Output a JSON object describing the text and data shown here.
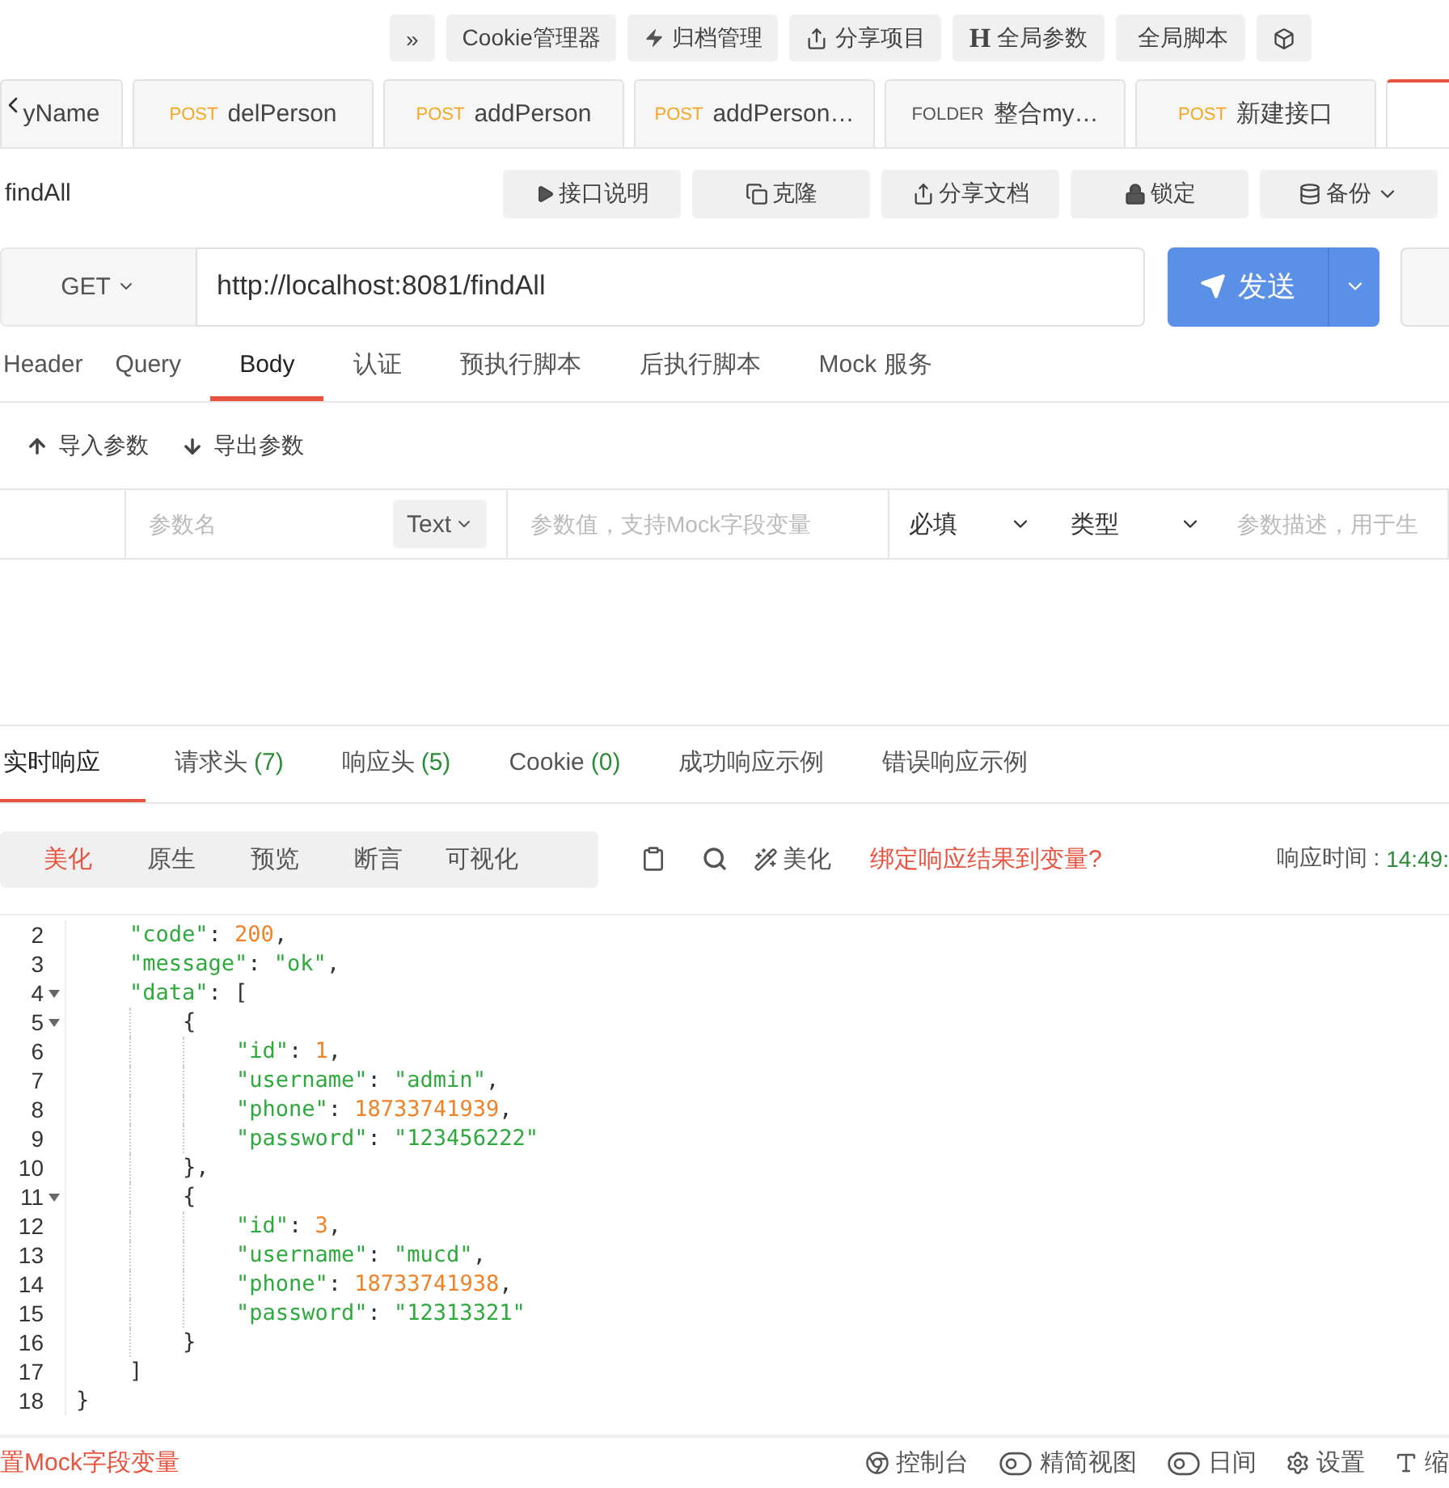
{
  "top_toolbar": [
    {
      "label": "»"
    },
    {
      "label": "Cookie管理器"
    },
    {
      "label": "归档管理"
    },
    {
      "label": "分享项目"
    },
    {
      "glyph": "H",
      "label": "全局参数"
    },
    {
      "label": "全局脚本"
    }
  ],
  "request_tabs": [
    {
      "label": "yName",
      "selected": false
    },
    {
      "method": "POST",
      "label": "delPerson",
      "selected": false
    },
    {
      "method": "POST",
      "label": "addPerson",
      "selected": false
    },
    {
      "method": "POST",
      "label": "addPerson…",
      "selected": false
    },
    {
      "method": "FOLDER",
      "label": "整合my…",
      "selected": false
    },
    {
      "method": "POST",
      "label": "新建接口",
      "selected": false
    },
    {
      "selected": true
    }
  ],
  "api_name": "findAll",
  "api_actions": [
    {
      "label": "接口说明"
    },
    {
      "label": "克隆"
    },
    {
      "label": "分享文档"
    },
    {
      "label": "锁定"
    },
    {
      "label": "备份"
    }
  ],
  "request": {
    "method": "GET",
    "url": "http://localhost:8081/findAll",
    "send": "发送"
  },
  "param_tabs": [
    {
      "label": "Header",
      "selected": false
    },
    {
      "label": "Query",
      "selected": false
    },
    {
      "label": "Body",
      "selected": true
    },
    {
      "label": "认证",
      "selected": false
    },
    {
      "label": "预执行脚本",
      "selected": false
    },
    {
      "label": "后执行脚本",
      "selected": false
    },
    {
      "label": "Mock 服务",
      "selected": false
    }
  ],
  "param_actions": [
    {
      "label": "导入参数"
    },
    {
      "label": "导出参数"
    }
  ],
  "param_row": {
    "name_placeholder": "参数名",
    "type": "Text",
    "value_placeholder": "参数值，支持Mock字段变量",
    "required": "必填",
    "field_type": "类型",
    "desc_placeholder": "参数描述，用于生"
  },
  "response_tabs": [
    {
      "label": "实时响应",
      "selected": true
    },
    {
      "label": "请求头",
      "count": "(7)",
      "selected": false
    },
    {
      "label": "响应头",
      "count": "(5)",
      "selected": false
    },
    {
      "label": "Cookie",
      "count": "(0)",
      "selected": false
    },
    {
      "label": "成功响应示例",
      "selected": false
    },
    {
      "label": "错误响应示例",
      "selected": false
    }
  ],
  "view_modes": [
    {
      "label": "美化",
      "selected": true
    },
    {
      "label": "原生",
      "selected": false
    },
    {
      "label": "预览",
      "selected": false
    },
    {
      "label": "断言",
      "selected": false
    },
    {
      "label": "可视化",
      "selected": false
    }
  ],
  "beautify": "美化",
  "bind_link": "绑定响应结果到变量?",
  "response_time_label": "响应时间 : ",
  "response_time": "14:49:",
  "code_body": [
    {
      "n": "2",
      "fold": false,
      "tokens": [
        {
          "kind": "key",
          "text": "\"code\""
        },
        {
          "kind": "punc",
          "text": ": "
        },
        {
          "kind": "num",
          "text": "200"
        },
        {
          "kind": "punc",
          "text": ","
        }
      ]
    },
    {
      "n": "3",
      "fold": false,
      "tokens": [
        {
          "kind": "key",
          "text": "\"message\""
        },
        {
          "kind": "punc",
          "text": ": "
        },
        {
          "kind": "str",
          "text": "\"ok\""
        },
        {
          "kind": "punc",
          "text": ","
        }
      ]
    },
    {
      "n": "4",
      "fold": true,
      "tokens": [
        {
          "kind": "key",
          "text": "\"data\""
        },
        {
          "kind": "punc",
          "text": ": ["
        }
      ],
      "children": [
        {
          "n": "5",
          "fold": true,
          "tokens": [
            {
              "kind": "punc",
              "text": "{"
            }
          ],
          "children": [
            {
              "n": "6",
              "fold": false,
              "tokens": [
                {
                  "kind": "key",
                  "text": "\"id\""
                },
                {
                  "kind": "punc",
                  "text": ": "
                },
                {
                  "kind": "num",
                  "text": "1"
                },
                {
                  "kind": "punc",
                  "text": ","
                }
              ]
            },
            {
              "n": "7",
              "fold": false,
              "tokens": [
                {
                  "kind": "key",
                  "text": "\"username\""
                },
                {
                  "kind": "punc",
                  "text": ": "
                },
                {
                  "kind": "str",
                  "text": "\"admin\""
                },
                {
                  "kind": "punc",
                  "text": ","
                }
              ]
            },
            {
              "n": "8",
              "fold": false,
              "tokens": [
                {
                  "kind": "key",
                  "text": "\"phone\""
                },
                {
                  "kind": "punc",
                  "text": ": "
                },
                {
                  "kind": "num",
                  "text": "18733741939"
                },
                {
                  "kind": "punc",
                  "text": ","
                }
              ]
            },
            {
              "n": "9",
              "fold": false,
              "tokens": [
                {
                  "kind": "key",
                  "text": "\"password\""
                },
                {
                  "kind": "punc",
                  "text": ": "
                },
                {
                  "kind": "str",
                  "text": "\"123456222\""
                }
              ]
            }
          ]
        },
        {
          "n": "10",
          "fold": false,
          "tokens": [
            {
              "kind": "punc",
              "text": "},"
            }
          ]
        },
        {
          "n": "11",
          "fold": true,
          "tokens": [
            {
              "kind": "punc",
              "text": "{"
            }
          ],
          "children": [
            {
              "n": "12",
              "fold": false,
              "tokens": [
                {
                  "kind": "key",
                  "text": "\"id\""
                },
                {
                  "kind": "punc",
                  "text": ": "
                },
                {
                  "kind": "num",
                  "text": "3"
                },
                {
                  "kind": "punc",
                  "text": ","
                }
              ]
            },
            {
              "n": "13",
              "fold": false,
              "tokens": [
                {
                  "kind": "key",
                  "text": "\"username\""
                },
                {
                  "kind": "punc",
                  "text": ": "
                },
                {
                  "kind": "str",
                  "text": "\"mucd\""
                },
                {
                  "kind": "punc",
                  "text": ","
                }
              ]
            },
            {
              "n": "14",
              "fold": false,
              "tokens": [
                {
                  "kind": "key",
                  "text": "\"phone\""
                },
                {
                  "kind": "punc",
                  "text": ": "
                },
                {
                  "kind": "num",
                  "text": "18733741938"
                },
                {
                  "kind": "punc",
                  "text": ","
                }
              ]
            },
            {
              "n": "15",
              "fold": false,
              "tokens": [
                {
                  "kind": "key",
                  "text": "\"password\""
                },
                {
                  "kind": "punc",
                  "text": ": "
                },
                {
                  "kind": "str",
                  "text": "\"12313321\""
                }
              ]
            }
          ]
        },
        {
          "n": "16",
          "fold": false,
          "tokens": [
            {
              "kind": "punc",
              "text": "}"
            }
          ]
        }
      ]
    },
    {
      "n": "17",
      "fold": false,
      "tokens": [
        {
          "kind": "punc",
          "text": "]"
        }
      ]
    }
  ],
  "code_end": {
    "n": "18",
    "fold": false,
    "tokens": [
      {
        "kind": "punc",
        "text": "}"
      }
    ]
  },
  "status_bar": {
    "mock_link": "置Mock字段变量",
    "items": [
      {
        "label": "控制台"
      },
      {
        "label": "精简视图"
      },
      {
        "label": "日间"
      },
      {
        "label": "设置"
      },
      {
        "label": "缩"
      }
    ]
  }
}
